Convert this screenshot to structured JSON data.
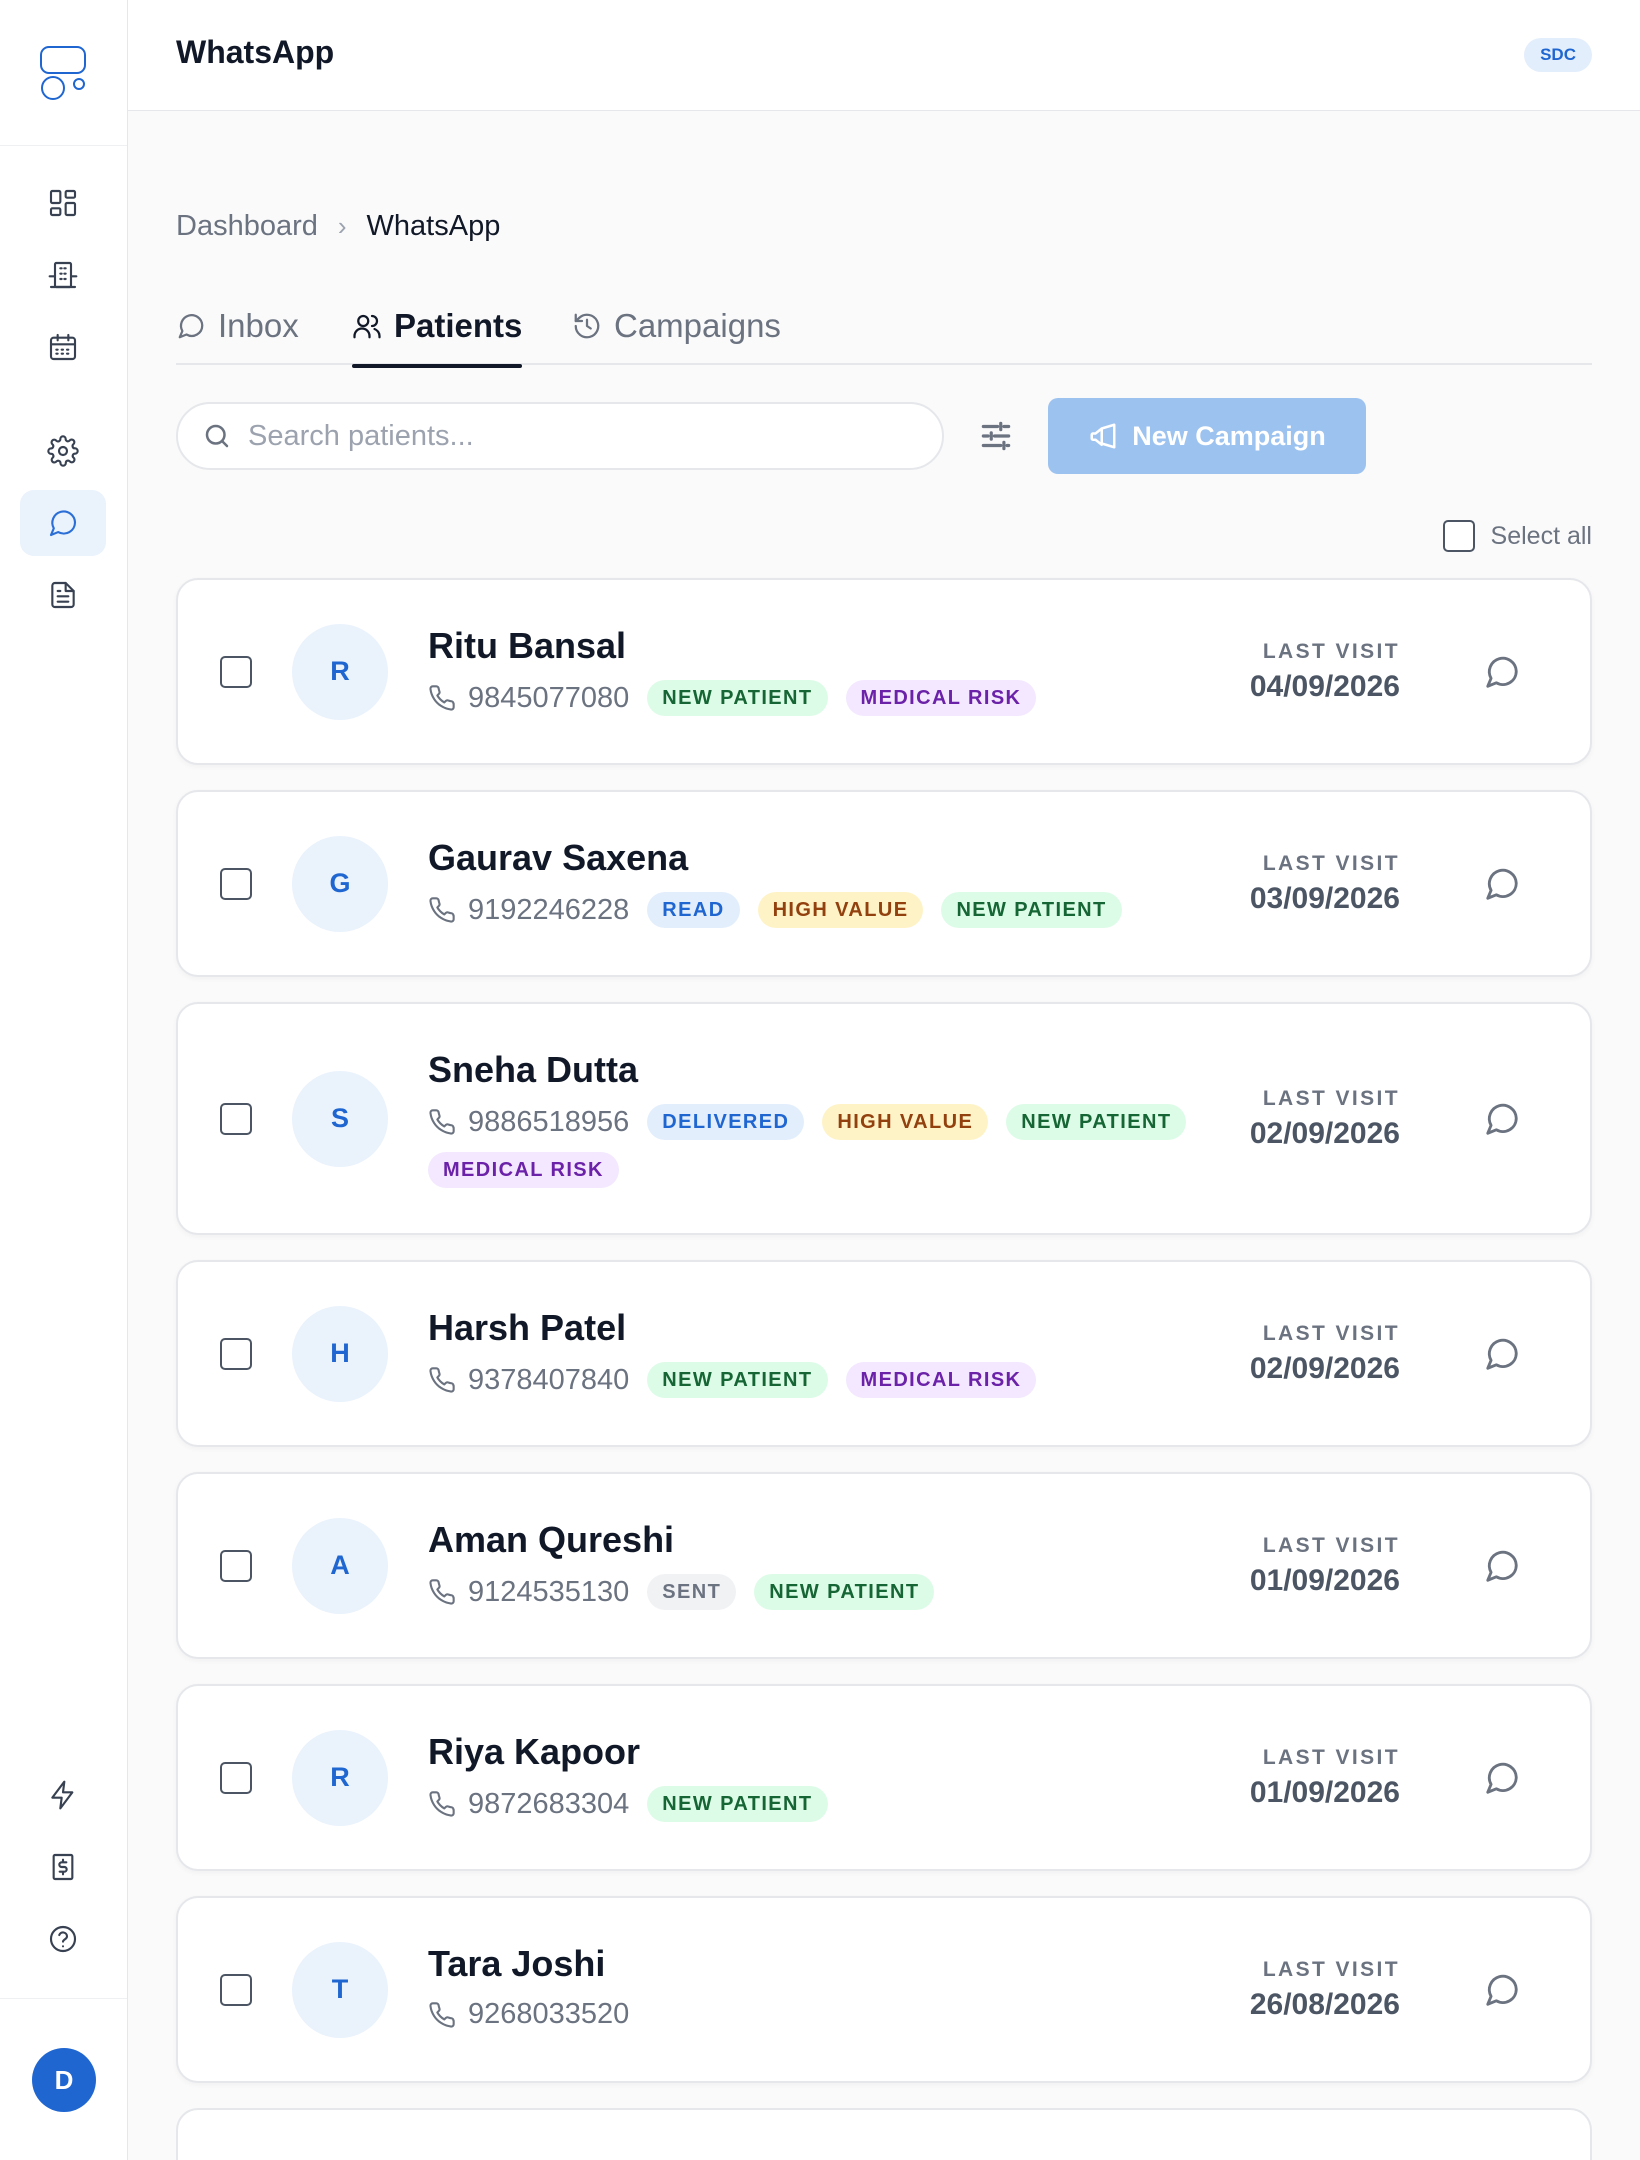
{
  "app": {
    "title": "WhatsApp",
    "org_badge": "SDC",
    "user_initial": "D"
  },
  "breadcrumb": {
    "parent": "Dashboard",
    "separator": "›",
    "current": "WhatsApp"
  },
  "tabs": [
    {
      "label": "Inbox",
      "icon": "chat-bubble-icon",
      "active": false
    },
    {
      "label": "Patients",
      "icon": "users-icon",
      "active": true
    },
    {
      "label": "Campaigns",
      "icon": "history-icon",
      "active": false
    }
  ],
  "toolbar": {
    "search_placeholder": "Search patients...",
    "search_value": "",
    "new_campaign_label": "New Campaign",
    "select_all_label": "Select all"
  },
  "patients": [
    {
      "initial": "R",
      "name": "Ritu Bansal",
      "phone": "9845077080",
      "tags": [
        "NEW PATIENT",
        "MEDICAL RISK"
      ],
      "last_visit_label": "LAST VISIT",
      "last_visit": "04/09/2026"
    },
    {
      "initial": "G",
      "name": "Gaurav Saxena",
      "phone": "9192246228",
      "tags": [
        "READ",
        "HIGH VALUE",
        "NEW PATIENT"
      ],
      "last_visit_label": "LAST VISIT",
      "last_visit": "03/09/2026"
    },
    {
      "initial": "S",
      "name": "Sneha Dutta",
      "phone": "9886518956",
      "tags": [
        "DELIVERED",
        "HIGH VALUE",
        "NEW PATIENT",
        "MEDICAL RISK"
      ],
      "last_visit_label": "LAST VISIT",
      "last_visit": "02/09/2026"
    },
    {
      "initial": "H",
      "name": "Harsh Patel",
      "phone": "9378407840",
      "tags": [
        "NEW PATIENT",
        "MEDICAL RISK"
      ],
      "last_visit_label": "LAST VISIT",
      "last_visit": "02/09/2026"
    },
    {
      "initial": "A",
      "name": "Aman Qureshi",
      "phone": "9124535130",
      "tags": [
        "SENT",
        "NEW PATIENT"
      ],
      "last_visit_label": "LAST VISIT",
      "last_visit": "01/09/2026"
    },
    {
      "initial": "R",
      "name": "Riya Kapoor",
      "phone": "9872683304",
      "tags": [
        "NEW PATIENT"
      ],
      "last_visit_label": "LAST VISIT",
      "last_visit": "01/09/2026"
    },
    {
      "initial": "T",
      "name": "Tara Joshi",
      "phone": "9268033520",
      "tags": [],
      "last_visit_label": "LAST VISIT",
      "last_visit": "26/08/2026"
    }
  ],
  "colors": {
    "accent": "#1f66d1",
    "button_disabled": "#9cc2f0",
    "active_nav_bg": "#eaf2fc"
  }
}
